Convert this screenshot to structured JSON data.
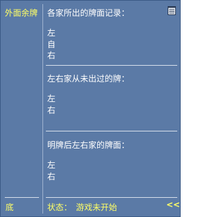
{
  "sidebar": {
    "title": "外面余牌",
    "bottom_label": "底"
  },
  "sections": {
    "discards": {
      "title": "各家所出的牌面记录：",
      "lines": [
        "左",
        "自",
        "右"
      ]
    },
    "never_played": {
      "title": "左右家从未出过的牌：",
      "lines": [
        "左",
        "右"
      ]
    },
    "after_reveal": {
      "title": "明牌后左右家的牌面：",
      "lines": [
        "左",
        "右"
      ]
    }
  },
  "status": {
    "label": "状态：",
    "value": "游戏未开始"
  },
  "collapse_label": "<<",
  "icons": {
    "record": "notepad-icon"
  },
  "colors": {
    "panel_bg": "#5b7aa6",
    "accent_yellow": "#ffff66",
    "text_white": "#ffffff"
  }
}
